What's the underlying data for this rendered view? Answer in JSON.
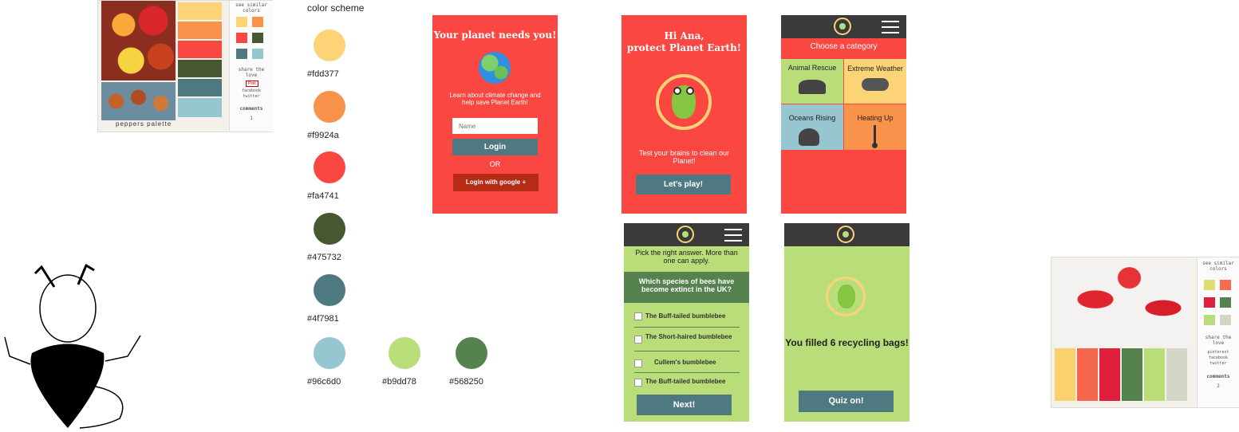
{
  "palette_card_1": {
    "caption": "peppers palette",
    "side_title": "see similar colors",
    "share": "share the love",
    "badge": "Pinit",
    "links": [
      "facebook",
      "twitter"
    ],
    "comments_label": "comments",
    "comments_count": "1",
    "swatches": [
      "#fdd377",
      "#f9924a",
      "#fa4741",
      "#475732",
      "#4f7981",
      "#96c6d0"
    ],
    "mini": [
      "#fdd377",
      "#f9924a",
      "#fa4741",
      "#475732",
      "#4f7981",
      "#96c6d0"
    ]
  },
  "scheme": {
    "title": "color scheme",
    "colors": [
      {
        "hex": "#fdd377",
        "label": "#fdd377"
      },
      {
        "hex": "#f9924a",
        "label": "#f9924a"
      },
      {
        "hex": "#fa4741",
        "label": "#fa4741"
      },
      {
        "hex": "#475732",
        "label": "#475732"
      },
      {
        "hex": "#4f7981",
        "label": "#4f7981"
      },
      {
        "hex": "#96c6d0",
        "label": "#96c6d0"
      },
      {
        "hex": "#b9dd78",
        "label": "#b9dd78"
      },
      {
        "hex": "#568250",
        "label": "#568250"
      }
    ]
  },
  "login": {
    "title": "Your planet needs you!",
    "text": "Learn about climate change and help save Planet Earth!",
    "name_placeholder": "Name",
    "login_btn": "Login",
    "or": "OR",
    "google_btn": "Login with google +"
  },
  "welcome": {
    "greeting": "Hi Ana,",
    "sub": "protect Planet Earth!",
    "text": "Test your brains to clean our Planet!",
    "play_btn": "Let's play!"
  },
  "categories": {
    "heading": "Choose a category",
    "items": [
      "Animal Rescue",
      "Extreme Weather",
      "Oceans Rising",
      "Heating Up"
    ]
  },
  "quiz": {
    "instruction": "Pick the right answer. More than one can apply.",
    "question": "Which species of bees have become extinct in the UK?",
    "options": [
      "The Buff-tailed bumblebee",
      "The Short-haired bumblebee",
      "Cullem's bumblebee",
      "The Buff-tailed bumblebee"
    ],
    "next_btn": "Next!"
  },
  "result": {
    "message": "You filled 6 recycling bags!",
    "quiz_btn": "Quiz on!"
  },
  "palette_card_2": {
    "side_title": "see similar colors",
    "share": "share the love",
    "links": [
      "pinterest",
      "facebook",
      "twitter"
    ],
    "comments_label": "comments",
    "comments_count": "2",
    "swatches": [
      "#f9d26d",
      "#f4674e",
      "#e01f3d",
      "#568250",
      "#b9dd78",
      "#d4d6c8"
    ],
    "mini": [
      "#e1dc72",
      "#f66a4f",
      "#e01f3d",
      "#568250",
      "#b9dd78",
      "#d4d6c8"
    ]
  },
  "colors": {
    "screen_red": "#fa4741",
    "button_teal": "#4f7981",
    "quiz_green": "#b9dd78",
    "dark_green": "#568250",
    "topbar": "#3a3a3a",
    "yellow": "#fdd377",
    "orange": "#f9924a",
    "light_blue": "#96c6d0",
    "google_red": "#b52b14"
  }
}
